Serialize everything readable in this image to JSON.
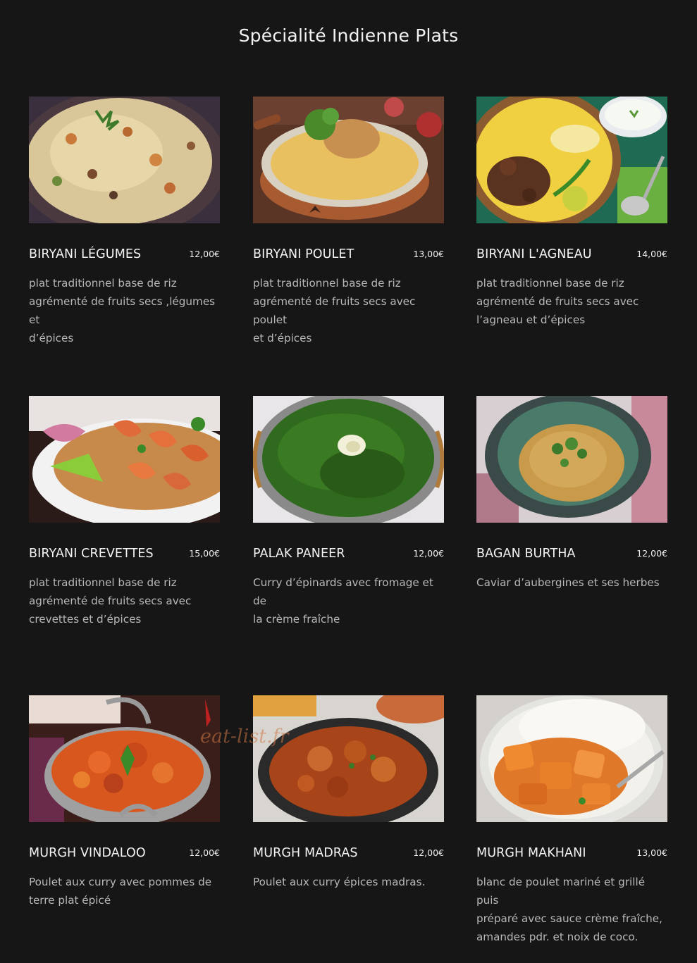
{
  "page": {
    "title": "Spécialité Indienne Plats",
    "watermark": "eat-list.fr"
  },
  "dishes": [
    {
      "name": "BIRYANI LÉGUMES",
      "price": "12,00€",
      "description": "plat traditionnel base de riz\nagrémenté de fruits secs ,légumes et\nd’épices",
      "image": "vegetable-biryani-photo"
    },
    {
      "name": "BIRYANI POULET",
      "price": "13,00€",
      "description": "plat traditionnel base de riz\nagrémenté de fruits secs avec poulet\n et d’épices",
      "image": "chicken-biryani-photo"
    },
    {
      "name": "BIRYANI L'AGNEAU",
      "price": "14,00€",
      "description": "plat traditionnel base de riz\nagrémenté de fruits secs avec\nl’agneau  et d’épices",
      "image": "lamb-biryani-photo"
    },
    {
      "name": "BIRYANI CREVETTES",
      "price": "15,00€",
      "description": "plat traditionnel base de riz\nagrémenté de fruits secs avec\ncrevettes  et d’épices",
      "image": "shrimp-biryani-photo"
    },
    {
      "name": "PALAK PANEER",
      "price": "12,00€",
      "description": "Curry d’épinards avec fromage et de\nla crème fraîche",
      "image": "palak-paneer-photo"
    },
    {
      "name": "BAGAN BURTHA",
      "price": "12,00€",
      "description": "Caviar d’aubergines et ses herbes",
      "image": "baingan-bharta-photo"
    },
    {
      "name": "MURGH VINDALOO",
      "price": "12,00€",
      "description": "Poulet aux  curry avec pommes de\nterre plat épicé",
      "image": "chicken-vindaloo-photo"
    },
    {
      "name": "MURGH MADRAS",
      "price": "12,00€",
      "description": "Poulet  aux curry épices madras.",
      "image": "chicken-madras-photo"
    },
    {
      "name": "MURGH MAKHANI",
      "price": "13,00€",
      "description": "blanc de poulet mariné et grillé puis\npréparé avec sauce crème fraîche,\namandes pdr. et noix de coco.",
      "image": "butter-chicken-photo"
    }
  ]
}
